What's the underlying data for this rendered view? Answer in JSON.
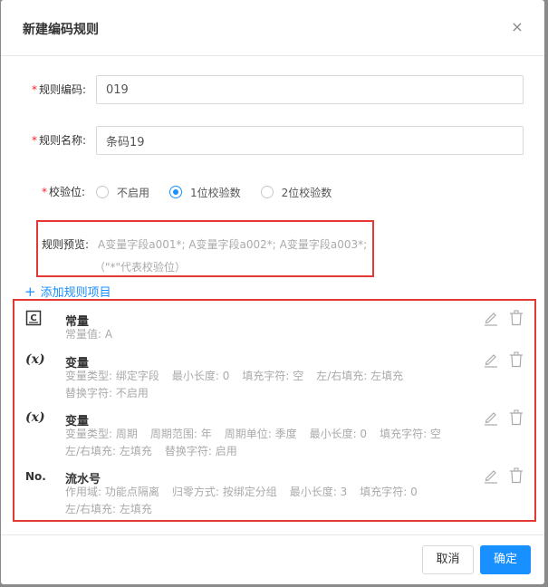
{
  "dialog": {
    "title": "新建编码规则",
    "close_glyph": "×"
  },
  "form": {
    "required_mark": "*",
    "code_label": "规则编码:",
    "code_value": "019",
    "name_label": "规则名称:",
    "name_value": "条码19",
    "check_label": "校验位:",
    "check_options": [
      "不启用",
      "1位校验数",
      "2位校验数"
    ],
    "check_selected": "1位校验数"
  },
  "preview": {
    "label": "规则预览:",
    "line1": "A变量字段a001*; A变量字段a002*; A变量字段a003*;",
    "line2": "（\"*\"代表校验位）"
  },
  "add_item": {
    "plus": "+",
    "label": "添加规则项目"
  },
  "items": [
    {
      "icon": "C",
      "icon_name": "constant-icon",
      "title": "常量",
      "lines": [
        [
          "常量值: A"
        ]
      ]
    },
    {
      "icon": "(x)",
      "icon_name": "variable-icon",
      "title": "变量",
      "lines": [
        [
          "变量类型: 绑定字段",
          "最小长度: 0",
          "填充字符: 空",
          "左/右填充: 左填充"
        ],
        [
          "替换字符: 不启用"
        ]
      ]
    },
    {
      "icon": "(x)",
      "icon_name": "variable-icon",
      "title": "变量",
      "lines": [
        [
          "变量类型: 周期",
          "周期范围: 年",
          "周期单位: 季度",
          "最小长度: 0",
          "填充字符: 空"
        ],
        [
          "左/右填充: 左填充",
          "替换字符: 启用"
        ]
      ]
    },
    {
      "icon": "No.",
      "icon_name": "serial-number-icon",
      "title": "流水号",
      "lines": [
        [
          "作用域: 功能点隔离",
          "归零方式: 按绑定分组",
          "最小长度: 3",
          "填充字符: 0"
        ],
        [
          "左/右填充: 左填充"
        ]
      ]
    }
  ],
  "footer": {
    "cancel_label": "取消",
    "ok_label": "确定"
  },
  "colors": {
    "primary": "#1890ff",
    "required": "#f5222d",
    "highlight_border": "#e53935"
  }
}
